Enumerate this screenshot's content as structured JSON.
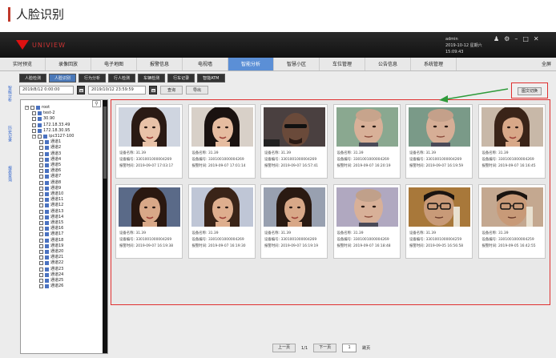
{
  "page": {
    "title": "人脸识别"
  },
  "app": {
    "logo_text": "UNIVIEW",
    "user": "admin",
    "date": "2019-10-12 星期六",
    "time": "15:09:43",
    "window_controls": [
      "user-icon",
      "gear-icon",
      "minimize-icon",
      "restore-icon",
      "close-icon"
    ]
  },
  "menu": {
    "items": [
      "实时预览",
      "录像回放",
      "电子地图",
      "报警信息",
      "电视墙",
      "智能分析",
      "智慧小区",
      "车位管理",
      "公告信息",
      "系统管理"
    ],
    "active": "智能分析",
    "fullscreen": "全屏"
  },
  "subtabs": {
    "items": [
      "人脸检测",
      "人脸识别",
      "行为分析",
      "行人检测",
      "车辆检测",
      "行车记录",
      "智能ATM"
    ],
    "active": "人脸识别"
  },
  "search": {
    "start": "2019/8/12 0:00:00",
    "end": "2019/10/12 23:59:59",
    "query": "查询",
    "export": "导出"
  },
  "side_tabs": [
    "智能分析",
    "历史记录",
    "报表查询"
  ],
  "tree": {
    "search_icon": "magnify-icon",
    "nodes": [
      {
        "label": "root",
        "indent": 0,
        "kind": "expand"
      },
      {
        "label": "test-2",
        "indent": 1,
        "kind": "cam"
      },
      {
        "label": "30.90",
        "indent": 1,
        "kind": "cam"
      },
      {
        "label": "172.18.33.49",
        "indent": 1,
        "kind": "cam"
      },
      {
        "label": "172.18.30.95",
        "indent": 1,
        "kind": "cam"
      },
      {
        "label": "ipc3127-100",
        "indent": 1,
        "kind": "expand"
      },
      {
        "label": "通道1",
        "indent": 2,
        "kind": "ch"
      },
      {
        "label": "通道2",
        "indent": 2,
        "kind": "ch"
      },
      {
        "label": "通道3",
        "indent": 2,
        "kind": "ch"
      },
      {
        "label": "通道4",
        "indent": 2,
        "kind": "ch"
      },
      {
        "label": "通道5",
        "indent": 2,
        "kind": "ch"
      },
      {
        "label": "通道6",
        "indent": 2,
        "kind": "ch"
      },
      {
        "label": "通道7",
        "indent": 2,
        "kind": "ch"
      },
      {
        "label": "通道8",
        "indent": 2,
        "kind": "ch"
      },
      {
        "label": "通道9",
        "indent": 2,
        "kind": "ch"
      },
      {
        "label": "通道10",
        "indent": 2,
        "kind": "ch"
      },
      {
        "label": "通道11",
        "indent": 2,
        "kind": "ch"
      },
      {
        "label": "通道12",
        "indent": 2,
        "kind": "ch"
      },
      {
        "label": "通道13",
        "indent": 2,
        "kind": "ch"
      },
      {
        "label": "通道14",
        "indent": 2,
        "kind": "ch"
      },
      {
        "label": "通道15",
        "indent": 2,
        "kind": "ch"
      },
      {
        "label": "通道16",
        "indent": 2,
        "kind": "ch"
      },
      {
        "label": "通道17",
        "indent": 2,
        "kind": "ch"
      },
      {
        "label": "通道18",
        "indent": 2,
        "kind": "ch"
      },
      {
        "label": "通道19",
        "indent": 2,
        "kind": "ch"
      },
      {
        "label": "通道20",
        "indent": 2,
        "kind": "ch"
      },
      {
        "label": "通道21",
        "indent": 2,
        "kind": "ch"
      },
      {
        "label": "通道22",
        "indent": 2,
        "kind": "ch"
      },
      {
        "label": "通道23",
        "indent": 2,
        "kind": "ch"
      },
      {
        "label": "通道24",
        "indent": 2,
        "kind": "ch"
      },
      {
        "label": "通道25",
        "indent": 2,
        "kind": "ch"
      },
      {
        "label": "通道26",
        "indent": 2,
        "kind": "ch"
      }
    ]
  },
  "toggle": {
    "label": "图文切换"
  },
  "cards": [
    {
      "name": "设备名称: 31.39",
      "id": "设备编号: 3301001000004269",
      "time": "报警时间: 2019-09-07 17:03:17",
      "face": "woman1",
      "bg": "#cfd5e0",
      "skin": "#e8c2a8",
      "hair": "#2a1a14"
    },
    {
      "name": "设备名称: 31.39",
      "id": "设备编号: 3301001000004269",
      "time": "报警时间: 2019-09-07 17:01:14",
      "face": "woman2",
      "bg": "#d8d0c8",
      "skin": "#e6bca0",
      "hair": "#1a1210"
    },
    {
      "name": "设备名称: 31.39",
      "id": "设备编号: 3301001000004269",
      "time": "报警时间: 2019-09-07 16:57:41",
      "face": "man-bald",
      "bg": "#4a4040",
      "skin": "#6a4a3a",
      "hair": "#5a3f30"
    },
    {
      "name": "设备名称: 31.39",
      "id": "设备编号: 3301001000004269",
      "time": "报警时间: 2019-09-07 16:20:19",
      "face": "man-shaved",
      "bg": "#8aa890",
      "skin": "#d8b098",
      "hair": "#c7a48c"
    },
    {
      "name": "设备名称: 31.39",
      "id": "设备编号: 3301001000004269",
      "time": "报警时间: 2019-09-07 16:19:59",
      "face": "man-shaved",
      "bg": "#7a9a88",
      "skin": "#d6ae96",
      "hair": "#c4a08a"
    },
    {
      "name": "设备名称: 31.39",
      "id": "设备编号: 3301001000004269",
      "time": "报警时间: 2019-09-07 16:16:45",
      "face": "woman3",
      "bg": "#c8b8a8",
      "skin": "#d8a888",
      "hair": "#3a2418"
    },
    {
      "name": "设备名称: 31.39",
      "id": "设备编号: 3301001000004269",
      "time": "报警时间: 2019-09-07 16:19:38",
      "face": "woman3",
      "bg": "#5a6a88",
      "skin": "#d8a888",
      "hair": "#2a1810"
    },
    {
      "name": "设备名称: 31.39",
      "id": "设备编号: 3301001000004269",
      "time": "报警时间: 2019-09-07 16:19:30",
      "face": "woman3",
      "bg": "#bfc6d6",
      "skin": "#deae8e",
      "hair": "#3a2418"
    },
    {
      "name": "设备名称: 31.39",
      "id": "设备编号: 3301001000004269",
      "time": "报警时间: 2019-09-07 16:19:19",
      "face": "woman3",
      "bg": "#98a0b0",
      "skin": "#d8a888",
      "hair": "#2a1a12"
    },
    {
      "name": "设备名称: 31.39",
      "id": "设备编号: 3301001000004269",
      "time": "报警时间: 2019-09-07 16:18:48",
      "face": "man-shaved",
      "bg": "#b0a8c0",
      "skin": "#d8b098",
      "hair": "#c0a08a"
    },
    {
      "name": "设备名称: 31.39",
      "id": "设备编号: 3301001000004259",
      "time": "报警时间: 2019-09-05 16:56:58",
      "face": "man-glasses",
      "bg": "#a8783a",
      "skin": "#c89a78",
      "hair": "#1a1410"
    },
    {
      "name": "设备名称: 31.39",
      "id": "设备编号: 3301001000004259",
      "time": "报警时间: 2019-09-05 16:42:55",
      "face": "man-glasses",
      "bg": "#c4a890",
      "skin": "#c89a78",
      "hair": "#1a1410"
    }
  ],
  "pager": {
    "prev": "上一页",
    "info": "1/1",
    "next": "下一页",
    "page": "1",
    "go": "跳页"
  },
  "colors": {
    "highlight": "#e03030",
    "active_tab": "#5b8fd6",
    "arrow": "#2e9a3a"
  }
}
